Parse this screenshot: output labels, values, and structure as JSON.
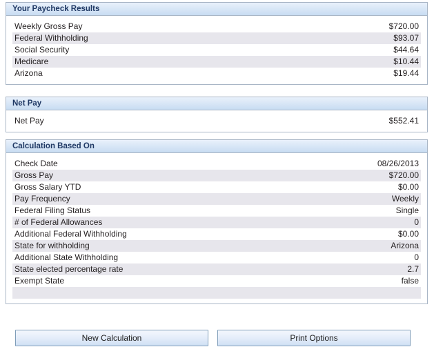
{
  "page": {
    "clipped_top_text": ""
  },
  "results_panel": {
    "title": "Your Paycheck Results",
    "rows": [
      {
        "label": "Weekly Gross Pay",
        "value": "$720.00"
      },
      {
        "label": "Federal Withholding",
        "value": "$93.07"
      },
      {
        "label": "Social Security",
        "value": "$44.64"
      },
      {
        "label": "Medicare",
        "value": "$10.44"
      },
      {
        "label": "Arizona",
        "value": "$19.44"
      }
    ]
  },
  "netpay_panel": {
    "title": "Net Pay",
    "rows": [
      {
        "label": "Net Pay",
        "value": "$552.41"
      }
    ]
  },
  "calculation_panel": {
    "title": "Calculation Based On",
    "rows": [
      {
        "label": "Check Date",
        "value": "08/26/2013"
      },
      {
        "label": "Gross Pay",
        "value": "$720.00"
      },
      {
        "label": "Gross Salary YTD",
        "value": "$0.00"
      },
      {
        "label": "Pay Frequency",
        "value": "Weekly"
      },
      {
        "label": "Federal Filing Status",
        "value": "Single"
      },
      {
        "label": "# of Federal Allowances",
        "value": "0"
      },
      {
        "label": "Additional Federal Withholding",
        "value": "$0.00"
      },
      {
        "label": "State for withholding",
        "value": "Arizona"
      },
      {
        "label": "Additional State Withholding",
        "value": "0"
      },
      {
        "label": "State elected percentage rate",
        "value": "2.7"
      },
      {
        "label": "Exempt State",
        "value": "false"
      },
      {
        "label": "",
        "value": ""
      }
    ]
  },
  "buttons": {
    "new_calculation": "New Calculation",
    "print_options": "Print Options"
  },
  "colors": {
    "panel_border": "#a9b6c6",
    "header_text": "#1f3864",
    "header_gradient_top": "#e9f1fb",
    "header_gradient_bottom": "#c7dcf2",
    "row_alt_background": "#e7e6ec",
    "body_text": "#231f20",
    "button_border": "#7f9db9"
  }
}
